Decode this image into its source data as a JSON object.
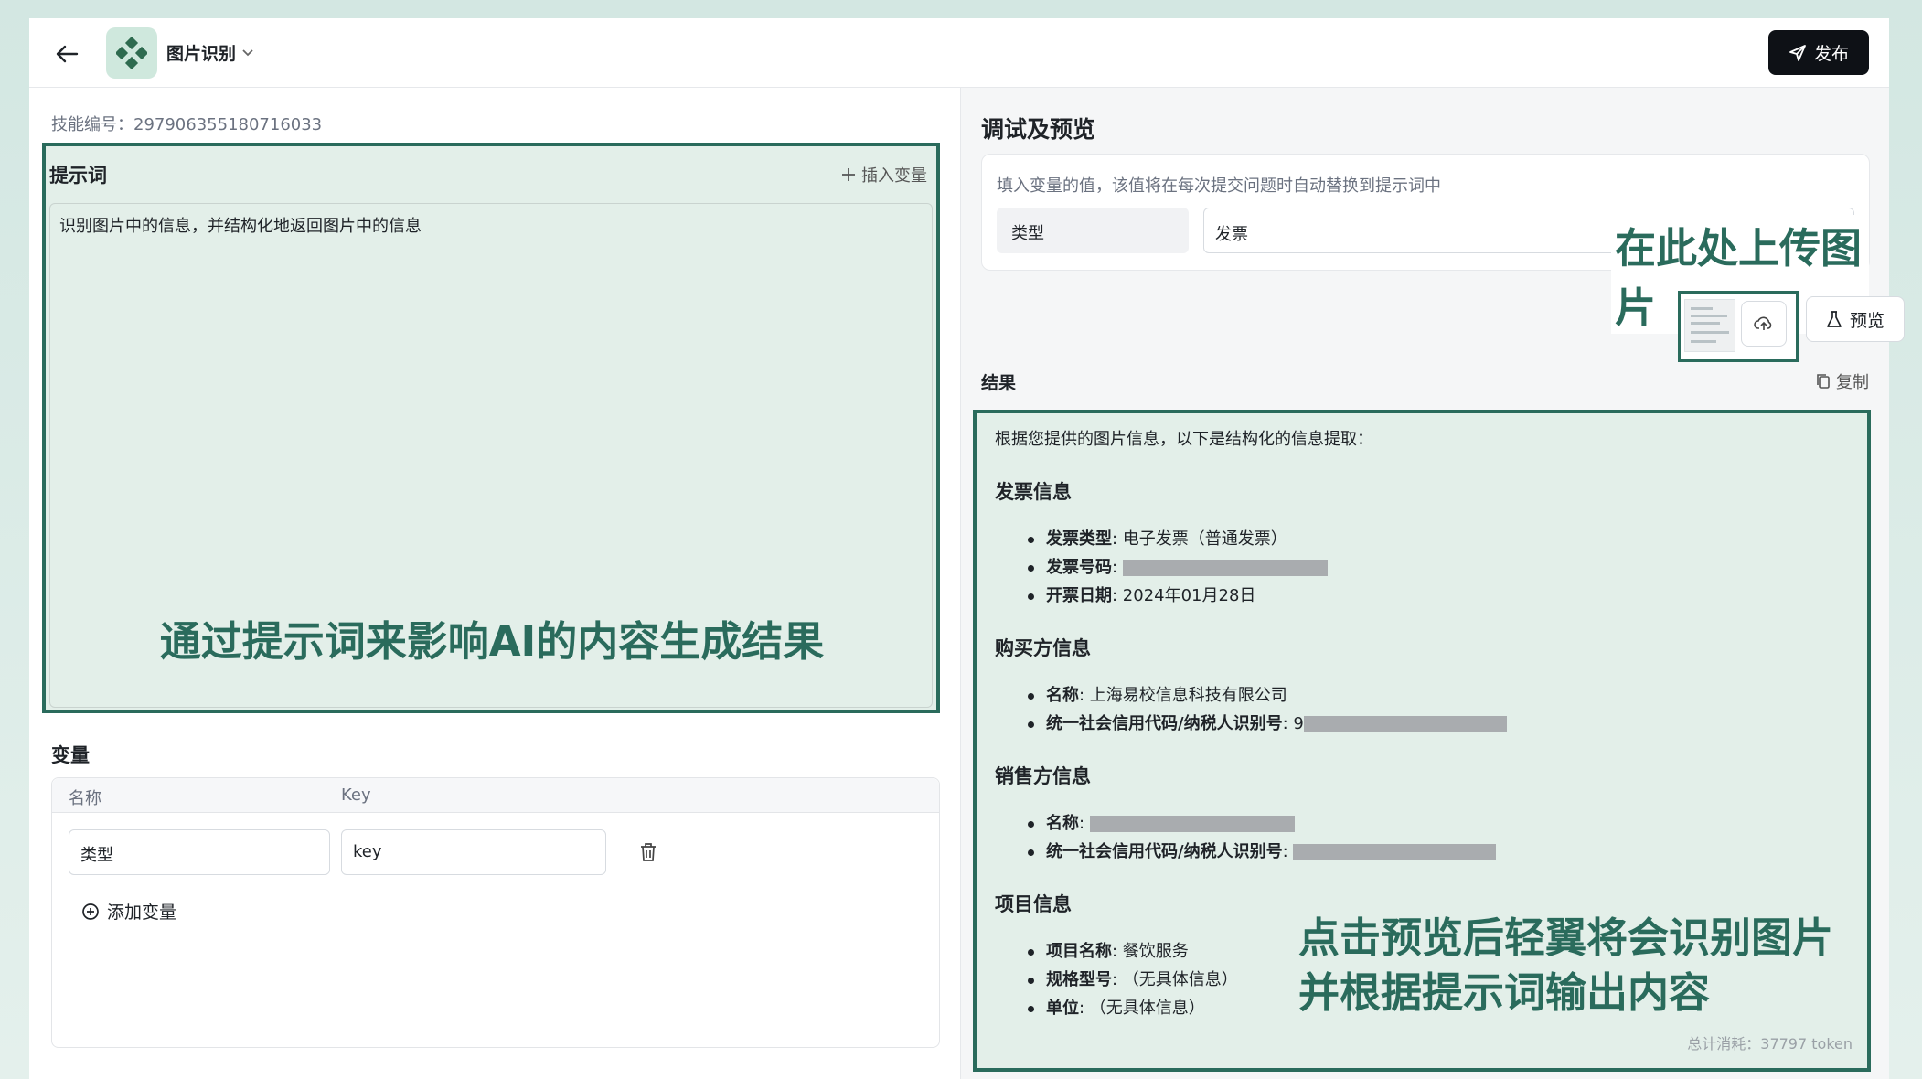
{
  "header": {
    "app_name": "图片识别",
    "publish_label": "发布"
  },
  "left": {
    "skill_id": "技能编号：297906355180716033",
    "prompt_heading": "提示词",
    "insert_variable": "插入变量",
    "prompt_text": "识别图片中的信息，并结构化地返回图片中的信息",
    "prompt_annotation": "通过提示词来影响AI的内容生成结果",
    "variables_heading": "变量",
    "columns": [
      "名称",
      "Key"
    ],
    "variables": [
      {
        "name": "类型",
        "key": "key"
      }
    ],
    "add_variable": "添加变量"
  },
  "right": {
    "title": "调试及预览",
    "var_hint": "填入变量的值，该值将在每次提交问题时自动替换到提示词中",
    "var_label": "类型",
    "var_value": "发票",
    "upload_annotation": "在此处上传图片",
    "preview_label": "预览",
    "result_label": "结果",
    "copy_label": "复制",
    "result": {
      "intro": "根据您提供的图片信息，以下是结构化的信息提取：",
      "sections": [
        {
          "heading": "发票信息",
          "items": [
            {
              "key": "发票类型",
              "value": ": 电子发票（普通发票）"
            },
            {
              "key": "发票号码",
              "value": ": ",
              "redacted": true
            },
            {
              "key": "开票日期",
              "value": ": 2024年01月28日"
            }
          ]
        },
        {
          "heading": "购买方信息",
          "items": [
            {
              "key": "名称",
              "value": ": 上海易校信息科技有限公司"
            },
            {
              "key": "统一社会信用代码/纳税人识别号",
              "value": ": 9",
              "redacted": true
            }
          ]
        },
        {
          "heading": "销售方信息",
          "items": [
            {
              "key": "名称",
              "value": ": ",
              "redacted": true
            },
            {
              "key": "统一社会信用代码/纳税人识别号",
              "value": ": ",
              "redacted": true
            }
          ]
        },
        {
          "heading": "项目信息",
          "items": [
            {
              "key": "项目名称",
              "value": ": 餐饮服务"
            },
            {
              "key": "规格型号",
              "value": ": （无具体信息）"
            },
            {
              "key": "单位",
              "value": ": （无具体信息）"
            }
          ]
        }
      ],
      "annotation_line1": "点击预览后轻翼将会识别图片",
      "annotation_line2": "并根据提示词输出内容",
      "token_total": "总计消耗：37797 token"
    }
  },
  "colors": {
    "accent": "#2a6b5c",
    "highlight_bg": "#e3efe9",
    "publish_bg": "#0e1116"
  }
}
